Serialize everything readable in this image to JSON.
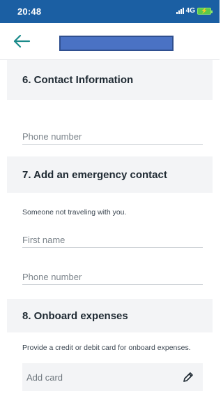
{
  "status_bar": {
    "time": "20:48",
    "network": "4G",
    "battery_color": "#5cc94a"
  },
  "header": {
    "back_icon": "arrow-left-icon",
    "title_redacted": true,
    "accent_color": "#1a8a8a"
  },
  "sections": {
    "contact": {
      "title": "6. Contact Information",
      "phone_placeholder": "Phone number"
    },
    "emergency": {
      "title": "7. Add an emergency contact",
      "description": "Someone not traveling with you.",
      "first_name_placeholder": "First name",
      "phone_placeholder": "Phone number"
    },
    "expenses": {
      "title": "8. Onboard expenses",
      "description": "Provide a credit or debit card for onboard expenses.",
      "add_card_label": "Add card",
      "edit_icon": "pencil-icon"
    }
  }
}
